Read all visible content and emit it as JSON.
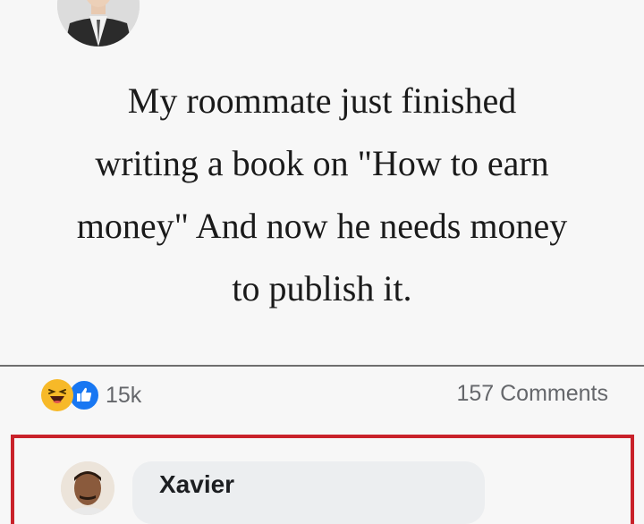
{
  "post": {
    "text": "My roommate just finished\nwriting a book on \"How to earn\nmoney\" And now he needs money\nto publish it."
  },
  "reactions": {
    "icons": [
      "haha-emoji",
      "like-thumb"
    ],
    "count": "15k"
  },
  "comments": {
    "count_label": "157 Comments",
    "first_author": "Xavier"
  },
  "colors": {
    "highlight_border": "#c9222a",
    "like_blue": "#1877f2",
    "haha_yellow": "#f7b928"
  }
}
